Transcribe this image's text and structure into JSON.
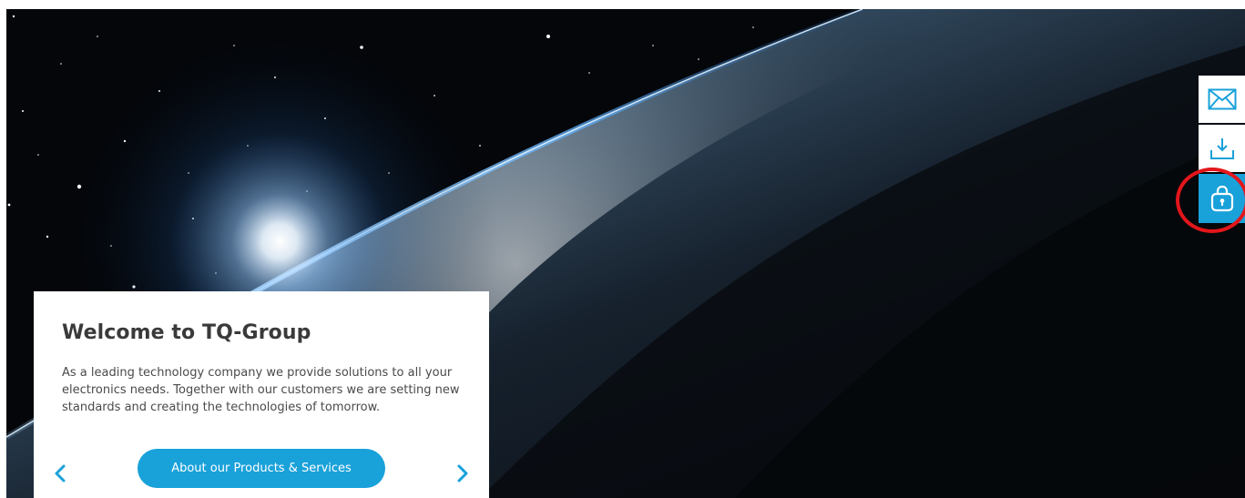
{
  "hero": {
    "welcome_title": "Welcome to TQ-Group",
    "welcome_text": "As a leading technology company we provide solutions to all your electronics needs. Together with our customers we are setting new standards and creating the technologies of tomorrow.",
    "cta_label": "About our Products & Services",
    "prev_icon": "chevron-left-icon",
    "next_icon": "chevron-right-icon"
  },
  "quick_actions": [
    {
      "icon": "mail-icon"
    },
    {
      "icon": "download-icon"
    },
    {
      "icon": "lock-icon",
      "active": true
    }
  ],
  "annotation": {
    "type": "red-circle",
    "target": "lock-icon"
  },
  "colors": {
    "accent": "#19a1da",
    "card_bg": "#ffffff",
    "title_text": "#3a3a3a",
    "body_text": "#4a4a4a",
    "highlight": "#e3161b",
    "space": "#04060a"
  }
}
